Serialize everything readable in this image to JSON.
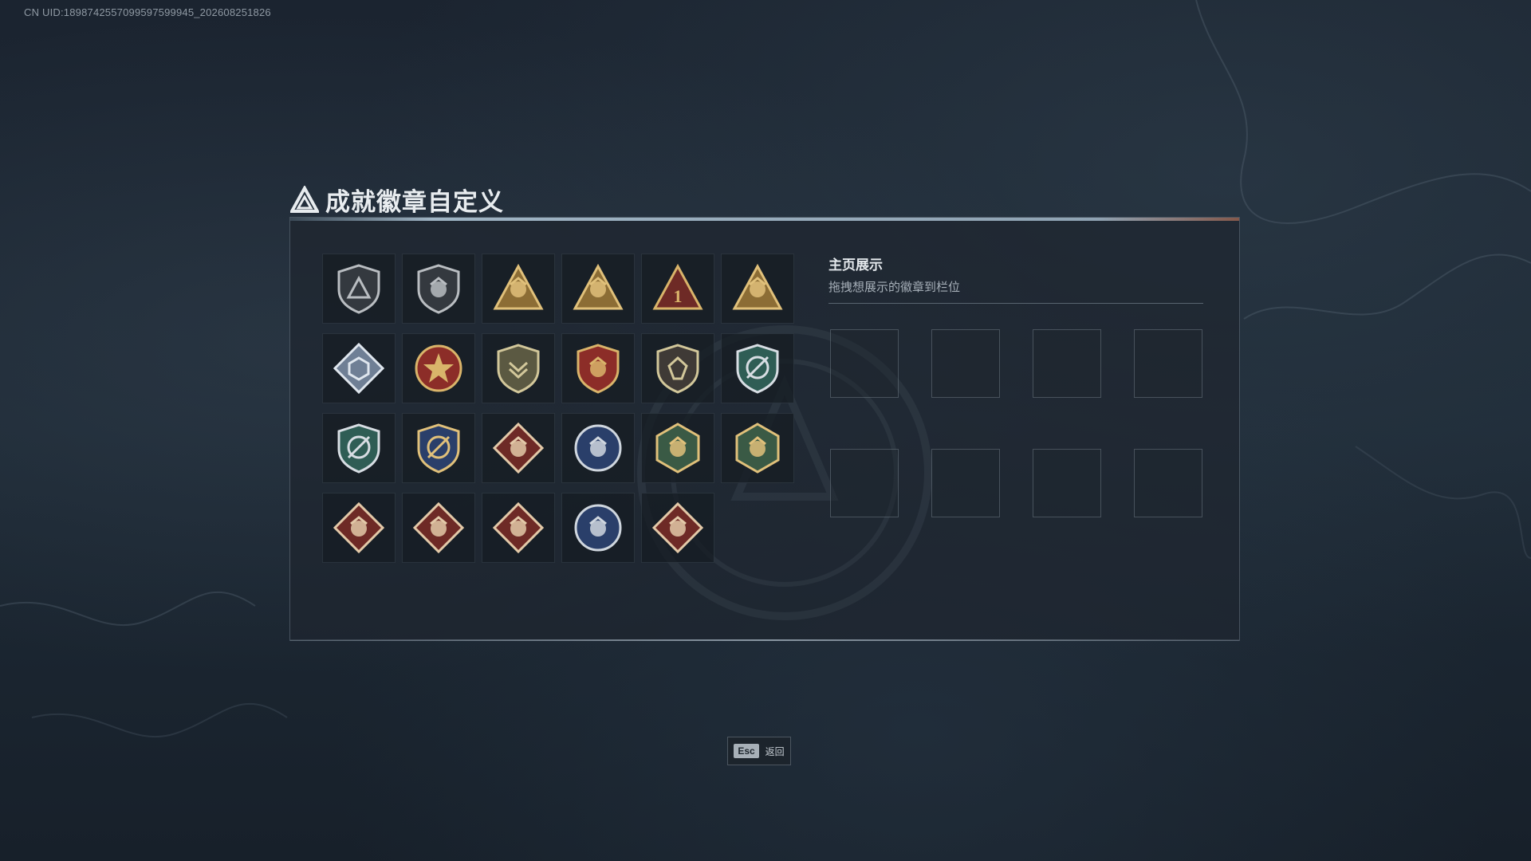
{
  "uid_text": "CN UID:1898742557099597599945_202608251826",
  "page_title": "成就徽章自定义",
  "colors": {
    "gold": "#c9a45a",
    "dark_red": "#6e2a26",
    "navy": "#2a3f6a",
    "olive_green": "#3a5a45"
  },
  "badges": [
    {
      "icon": "shield-triangle-icon",
      "shape": "shield",
      "fill": "#34393f",
      "emblem": "triangle",
      "accent": "#b9bdc1"
    },
    {
      "icon": "helicopter-shield-icon",
      "shape": "shield",
      "fill": "#34393f",
      "emblem": "heli",
      "accent": "#b9bdc1"
    },
    {
      "icon": "gold-triangle-jet-icon",
      "shape": "triangle",
      "fill": "#8c6d35",
      "emblem": "jet",
      "accent": "#e0c07a"
    },
    {
      "icon": "gold-triangle-tank-icon",
      "shape": "triangle",
      "fill": "#8c6d35",
      "emblem": "tank",
      "accent": "#e0c07a"
    },
    {
      "icon": "red-triangle-number-one-icon",
      "shape": "triangle",
      "fill": "#6e2a26",
      "emblem": "one",
      "accent": "#d9b46a"
    },
    {
      "icon": "gold-triangle-soldiers-icon",
      "shape": "triangle",
      "fill": "#8c6d35",
      "emblem": "soldiers",
      "accent": "#e0c07a"
    },
    {
      "icon": "silver-diamond-emblem-icon",
      "shape": "diamond",
      "fill": "#6f7f95",
      "emblem": "cube",
      "accent": "#dfe6ee"
    },
    {
      "icon": "gold-star-medal-icon",
      "shape": "circle",
      "fill": "#8c2d28",
      "emblem": "star",
      "accent": "#d9b46a"
    },
    {
      "icon": "olive-shield-emblem-icon",
      "shape": "shield",
      "fill": "#5b5942",
      "emblem": "chevron",
      "accent": "#d2c79a"
    },
    {
      "icon": "red-gold-crest-icon",
      "shape": "shield",
      "fill": "#8c2d28",
      "emblem": "crest",
      "accent": "#d9b46a"
    },
    {
      "icon": "dark-shield-crystal-icon",
      "shape": "shield",
      "fill": "#3f3a36",
      "emblem": "crystal",
      "accent": "#d2c79a"
    },
    {
      "icon": "green-crosshair-shield-icon",
      "shape": "shield",
      "fill": "#2f5d55",
      "emblem": "crosshair",
      "accent": "#d7dde3"
    },
    {
      "icon": "blue-crosshair-shield-icon",
      "shape": "shield",
      "fill": "#2f5d55",
      "emblem": "crosshair",
      "accent": "#d7dde3"
    },
    {
      "icon": "gold-crosshair-shield-icon",
      "shape": "shield",
      "fill": "#2a3f6a",
      "emblem": "crosshair",
      "accent": "#e0c07a"
    },
    {
      "icon": "red-diamond-wolf-icon",
      "shape": "diamond",
      "fill": "#6e2a26",
      "emblem": "beast",
      "accent": "#e3c9a8"
    },
    {
      "icon": "blue-circle-eagle-icon",
      "shape": "circle",
      "fill": "#2a3f6a",
      "emblem": "eagle",
      "accent": "#cfd6de"
    },
    {
      "icon": "green-hexagon-wasp-icon",
      "shape": "hexagon",
      "fill": "#3a5a45",
      "emblem": "wasp",
      "accent": "#e0c07a"
    },
    {
      "icon": "green-hexagon-hornet-icon",
      "shape": "hexagon",
      "fill": "#3a5a45",
      "emblem": "hornet",
      "accent": "#e0c07a"
    },
    {
      "icon": "red-diamond-dragon-icon",
      "shape": "diamond",
      "fill": "#6e2a26",
      "emblem": "dragon",
      "accent": "#e3c9a8"
    },
    {
      "icon": "red-diamond-dragon-2-icon",
      "shape": "diamond",
      "fill": "#6e2a26",
      "emblem": "dragon",
      "accent": "#e3c9a8"
    },
    {
      "icon": "red-diamond-runner-icon",
      "shape": "diamond",
      "fill": "#6e2a26",
      "emblem": "runner",
      "accent": "#e3c9a8"
    },
    {
      "icon": "blue-circle-wolf-icon",
      "shape": "circle",
      "fill": "#2a3f6a",
      "emblem": "wolf",
      "accent": "#cfd6de"
    },
    {
      "icon": "red-diamond-serpent-icon",
      "shape": "diamond",
      "fill": "#6e2a26",
      "emblem": "serpent",
      "accent": "#e3c9a8"
    }
  ],
  "showcase": {
    "title": "主页展示",
    "subtitle": "拖拽想展示的徽章到栏位",
    "slot_count": 8
  },
  "esc_button": {
    "key": "Esc",
    "label": "返回"
  }
}
